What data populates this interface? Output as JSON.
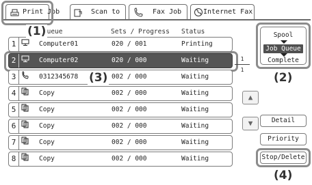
{
  "tabs": [
    {
      "label": "Print Job",
      "icon": "printer-icon",
      "active": true
    },
    {
      "label": "Scan to",
      "icon": "scan-icon",
      "active": false
    },
    {
      "label": "Fax Job",
      "icon": "fax-icon",
      "active": false
    },
    {
      "label": "Internet Fax",
      "icon": "internet-fax-icon",
      "active": false
    }
  ],
  "columns": {
    "queue": "Job Queue",
    "progress": "Sets / Progress",
    "status": "Status"
  },
  "jobs": [
    {
      "num": "1",
      "icon": "computer-icon",
      "name": "Computer01",
      "progress": "020 / 001",
      "status": "Printing"
    },
    {
      "num": "2",
      "icon": "computer-icon",
      "name": "Computer02",
      "progress": "020 / 000",
      "status": "Waiting"
    },
    {
      "num": "3",
      "icon": "phone-icon",
      "name": "0312345678",
      "progress": "002 / 000",
      "status": "Waiting"
    },
    {
      "num": "4",
      "icon": "copy-icon",
      "name": "Copy",
      "progress": "002 / 000",
      "status": "Waiting"
    },
    {
      "num": "5",
      "icon": "copy-icon",
      "name": "Copy",
      "progress": "002 / 000",
      "status": "Waiting"
    },
    {
      "num": "6",
      "icon": "copy-icon",
      "name": "Copy",
      "progress": "002 / 000",
      "status": "Waiting"
    },
    {
      "num": "7",
      "icon": "copy-icon",
      "name": "Copy",
      "progress": "002 / 000",
      "status": "Waiting"
    },
    {
      "num": "8",
      "icon": "copy-icon",
      "name": "Copy",
      "progress": "002 / 000",
      "status": "Waiting"
    }
  ],
  "selected_job": 2,
  "page": {
    "current": "1",
    "total": "1"
  },
  "spool_panel": {
    "spool": "Spool",
    "job_queue": "Job Queue",
    "complete": "Complete"
  },
  "buttons": {
    "detail": "Detail",
    "priority": "Priority",
    "stop_delete": "Stop/Delete"
  },
  "callouts": [
    "(1)",
    "(2)",
    "(3)",
    "(4)"
  ],
  "colors": {
    "selected_row": "#555555",
    "highlight": "#8c8c8c"
  }
}
